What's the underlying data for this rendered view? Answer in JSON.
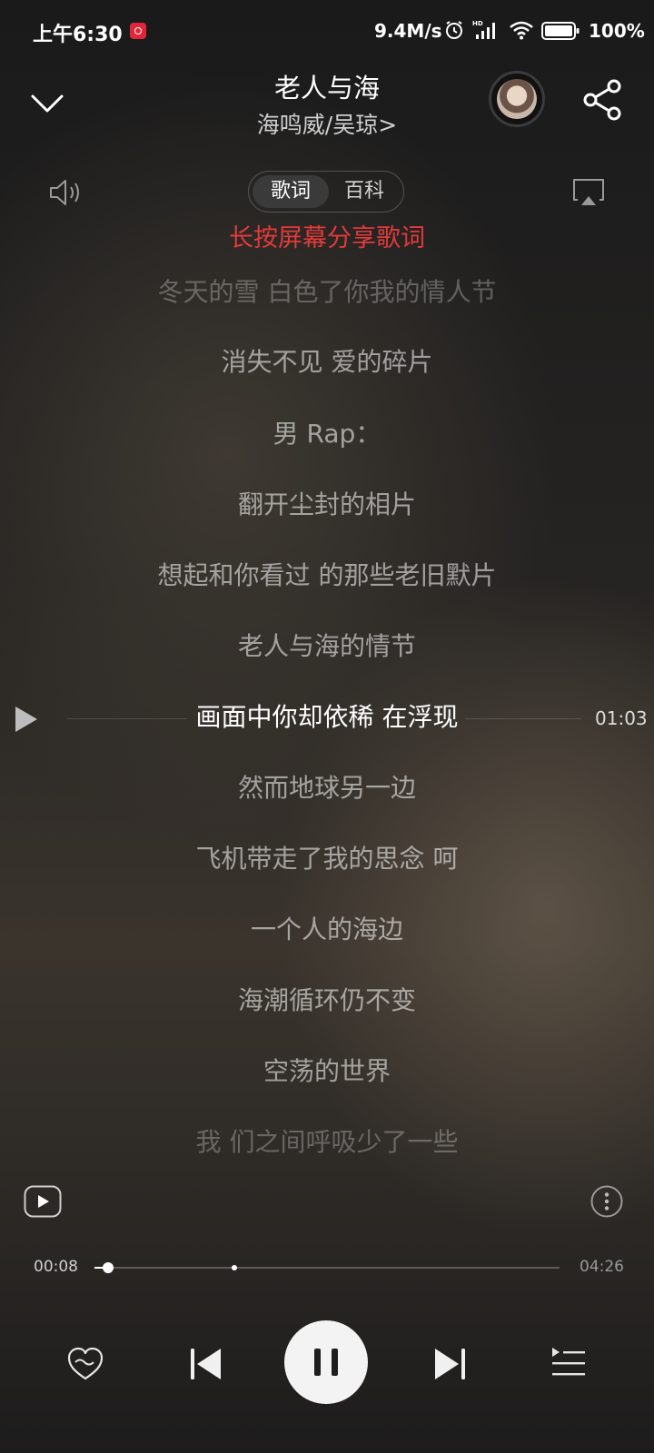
{
  "status_bar": {
    "time": "上午6:30",
    "network_speed": "9.4M/s",
    "battery": "100%",
    "icons": [
      "app-notification-icon",
      "alarm-icon",
      "hd-signal-icon",
      "wifi-icon",
      "battery-icon"
    ]
  },
  "header": {
    "title": "老人与海",
    "artist": "海鸣威/吴琼",
    "artist_chevron": ">"
  },
  "tabs": [
    {
      "label": "歌词",
      "active": true
    },
    {
      "label": "百科",
      "active": false
    }
  ],
  "hint": "长按屏幕分享歌词",
  "lyrics": [
    {
      "text": "冬天的雪 白色了你我的情人节",
      "state": "faded"
    },
    {
      "text": "消失不见 爱的碎片",
      "state": "normal"
    },
    {
      "text": "男 Rap：",
      "state": "normal"
    },
    {
      "text": "翻开尘封的相片",
      "state": "normal"
    },
    {
      "text": "想起和你看过 的那些老旧默片",
      "state": "normal"
    },
    {
      "text": "老人与海的情节",
      "state": "normal"
    },
    {
      "text": "画面中你却依稀 在浮现",
      "state": "current"
    },
    {
      "text": "然而地球另一边",
      "state": "normal"
    },
    {
      "text": "飞机带走了我的思念 呵",
      "state": "normal"
    },
    {
      "text": "一个人的海边",
      "state": "normal"
    },
    {
      "text": "海潮循环仍不变",
      "state": "normal"
    },
    {
      "text": "空荡的世界",
      "state": "normal"
    },
    {
      "text": "我 们之间呼吸少了一些",
      "state": "faded"
    }
  ],
  "seek_line": {
    "time": "01:03"
  },
  "progress": {
    "current": "00:08",
    "total": "04:26",
    "fraction": 0.03,
    "buffered_fraction": 0.3
  },
  "controls": {
    "icons": [
      "heart-icon",
      "previous-icon",
      "pause-icon",
      "next-icon",
      "playlist-icon"
    ]
  },
  "colors": {
    "hint": "#e23a3a",
    "badge": "#e2263a"
  }
}
